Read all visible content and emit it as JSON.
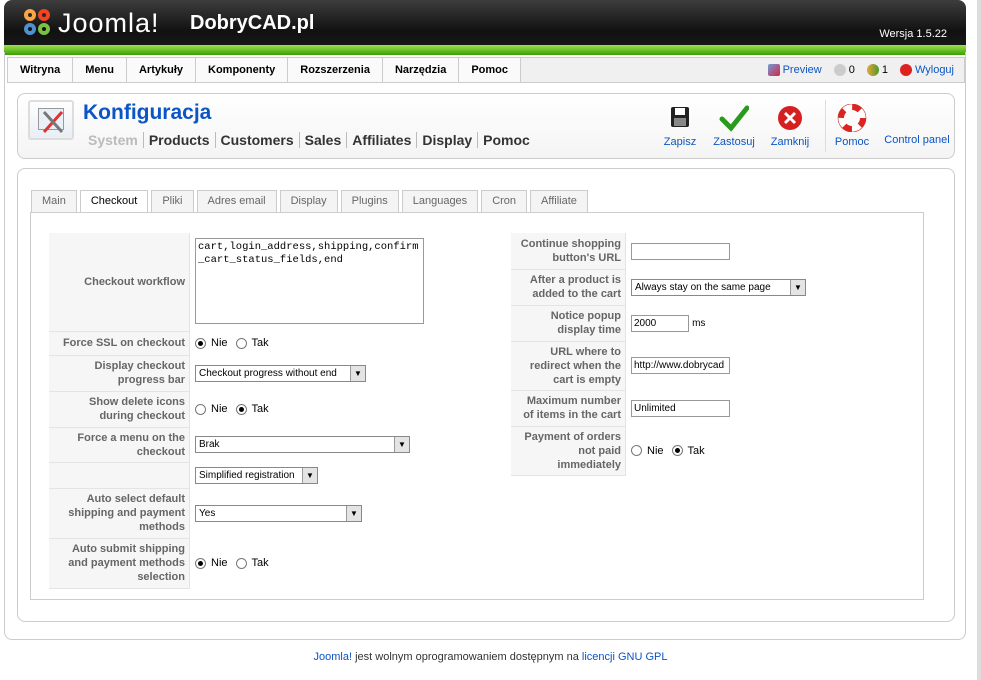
{
  "header": {
    "logo_text": "Joomla!",
    "site_name": "DobryCAD.pl",
    "version": "Wersja 1.5.22"
  },
  "menu": {
    "items": [
      {
        "label": "Witryna"
      },
      {
        "label": "Menu"
      },
      {
        "label": "Artykuły"
      },
      {
        "label": "Komponenty"
      },
      {
        "label": "Rozszerzenia"
      },
      {
        "label": "Narzędzia"
      },
      {
        "label": "Pomoc"
      }
    ],
    "status": {
      "preview": "Preview",
      "messages": "0",
      "users": "1",
      "logout": "Wyloguj"
    }
  },
  "toolbar": {
    "title": "Konfiguracja",
    "subnav": [
      "System",
      "Products",
      "Customers",
      "Sales",
      "Affiliates",
      "Display",
      "Pomoc"
    ],
    "buttons": {
      "save": "Zapisz",
      "apply": "Zastosuj",
      "close": "Zamknij",
      "help": "Pomoc",
      "control_panel": "Control panel"
    }
  },
  "tabs": [
    "Main",
    "Checkout",
    "Pliki",
    "Adres email",
    "Display",
    "Plugins",
    "Languages",
    "Cron",
    "Affiliate"
  ],
  "active_tab": "Checkout",
  "left_form": {
    "checkout_workflow": {
      "label": "Checkout workflow",
      "value": "cart,login_address,shipping,confirm_cart_status_fields,end"
    },
    "force_ssl": {
      "label": "Force SSL on checkout",
      "options": [
        "Nie",
        "Tak"
      ],
      "selected": "Nie"
    },
    "progress_bar": {
      "label": "Display checkout progress bar",
      "value": "Checkout progress without end"
    },
    "delete_icons": {
      "label": "Show delete icons during checkout",
      "options": [
        "Nie",
        "Tak"
      ],
      "selected": "Tak"
    },
    "force_menu": {
      "label": "Force a menu on the checkout",
      "value": "Brak"
    },
    "registration": {
      "label": "",
      "value": "Simplified registration"
    },
    "auto_select": {
      "label": "Auto select default shipping and payment methods",
      "value": "Yes"
    },
    "auto_submit": {
      "label": "Auto submit shipping and payment methods selection",
      "options": [
        "Nie",
        "Tak"
      ],
      "selected": "Nie"
    }
  },
  "right_form": {
    "continue_url": {
      "label": "Continue shopping button's URL",
      "value": ""
    },
    "after_add": {
      "label": "After a product is added to the cart",
      "value": "Always stay on the same page"
    },
    "popup_time": {
      "label": "Notice popup display time",
      "value": "2000",
      "unit": "ms"
    },
    "redirect_url": {
      "label": "URL where to redirect when the cart is empty",
      "value": "http://www.dobrycad"
    },
    "max_items": {
      "label": "Maximum number of items in the cart",
      "value": "Unlimited"
    },
    "not_paid": {
      "label": "Payment of orders not paid immediately",
      "options": [
        "Nie",
        "Tak"
      ],
      "selected": "Tak"
    }
  },
  "footer": {
    "link1": "Joomla!",
    "text": " jest wolnym oprogramowaniem dostępnym na ",
    "link2": "licencji GNU GPL"
  }
}
